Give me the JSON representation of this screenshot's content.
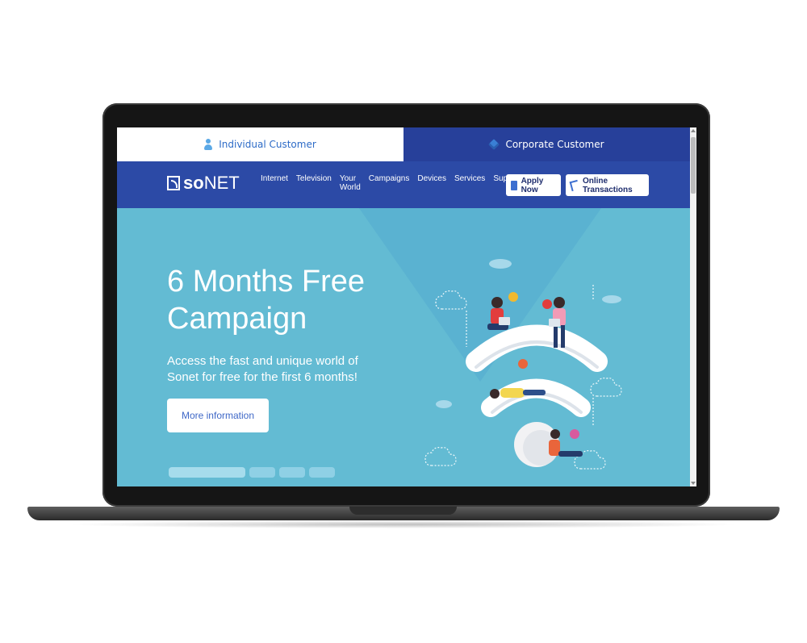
{
  "customer_tabs": {
    "individual": "Individual Customer",
    "corporate": "Corporate Customer"
  },
  "nav": {
    "logo_bold": "so",
    "logo_rest": "NET",
    "links": [
      "Internet",
      "Television",
      "Your\nWorld",
      "Campaigns",
      "Devices",
      "Services",
      "Support"
    ],
    "apply_now": "Apply Now",
    "online_transactions": "Online Transactions"
  },
  "hero": {
    "title": "6 Months Free Campaign",
    "subtitle": "Access the fast and unique world of Sonet for free for the first 6 months!",
    "button": "More information",
    "slides": 4,
    "active_slide": 1
  },
  "colors": {
    "hero_bg": "#63bbd3",
    "nav_bg": "#2c4aa6",
    "corporate_tab_bg": "#27409a",
    "accent": "#3f68c7"
  }
}
